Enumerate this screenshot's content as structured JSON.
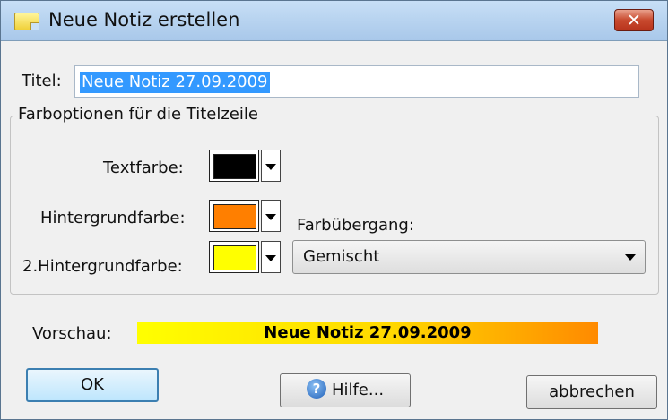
{
  "window": {
    "title": "Neue Notiz erstellen",
    "close_glyph": "✕"
  },
  "titel": {
    "label": "Titel:",
    "value": "Neue Notiz 27.09.2009"
  },
  "group": {
    "legend": "Farboptionen für die Titelzeile",
    "textfarbe": {
      "label": "Textfarbe:",
      "color": "#000000"
    },
    "hintergrund": {
      "label": "Hintergrundfarbe:",
      "color": "#ff7f00"
    },
    "hintergrund2": {
      "label": "2.Hintergrundfarbe:",
      "color": "#ffff00"
    },
    "farbuebergang": {
      "label": "Farbübergang:",
      "value": "Gemischt"
    }
  },
  "preview": {
    "label": "Vorschau:",
    "text": "Neue Notiz 27.09.2009"
  },
  "buttons": {
    "ok": "OK",
    "help": "Hilfe...",
    "help_icon_glyph": "?",
    "cancel": "abbrechen"
  }
}
